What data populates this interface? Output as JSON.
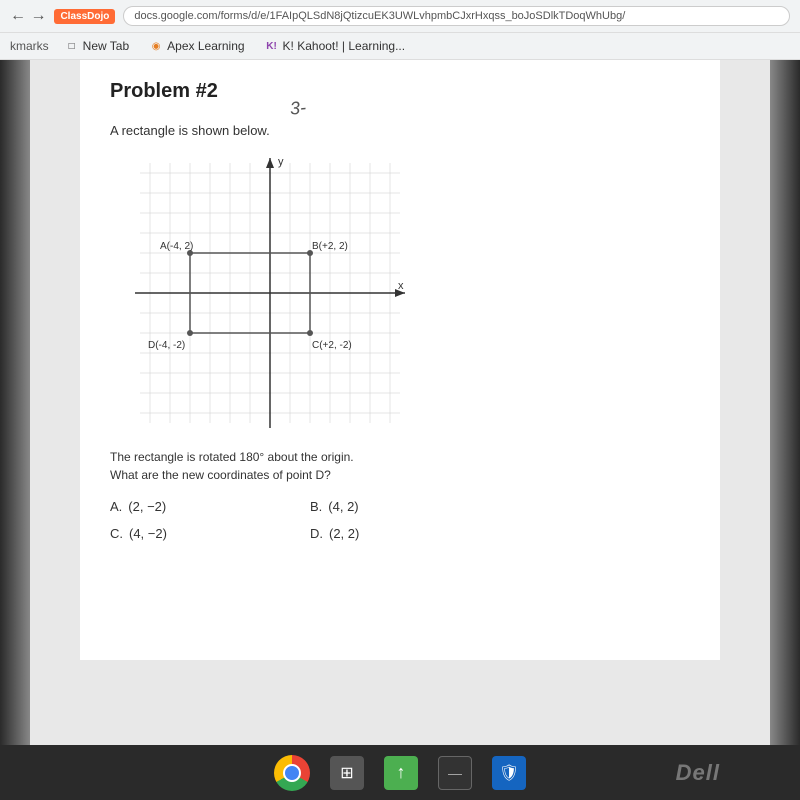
{
  "browser": {
    "url": "docs.google.com/forms/d/e/1FAIpQLSdN8jQtizcuEK3UWLvhpmbCJxrHxqss_boJoSDlkTDoqWhUbg/",
    "classdojo_badge": "ClassDojo",
    "bookmarks": [
      {
        "label": "New Tab",
        "icon": "□"
      },
      {
        "label": "Apex Learning",
        "icon": "◉"
      },
      {
        "label": "K! Kahoot! | Learning...",
        "icon": "K!"
      }
    ]
  },
  "problem": {
    "title": "Problem #2",
    "annotation": "3-",
    "description": "A rectangle is shown below.",
    "rotation_text_line1": "The rectangle is rotated 180° about the origin.",
    "rotation_text_line2": "What are the new coordinates of point D?",
    "points": {
      "A": "A(-4, 2)",
      "B": "B(+2, 2)",
      "C": "C(+2, -2)",
      "D": "D(-4, -2)"
    },
    "axes": {
      "x_label": "x",
      "y_label": "y"
    },
    "choices": [
      {
        "label": "A.",
        "value": "(2, −2)"
      },
      {
        "label": "B.",
        "value": "(4, 2)"
      },
      {
        "label": "C.",
        "value": "(4, −2)"
      },
      {
        "label": "D.",
        "value": "(2, 2)"
      }
    ]
  },
  "taskbar": {
    "icons": [
      "chrome",
      "files",
      "green-app",
      "dark-app",
      "security"
    ]
  },
  "dell_logo": "Dell"
}
